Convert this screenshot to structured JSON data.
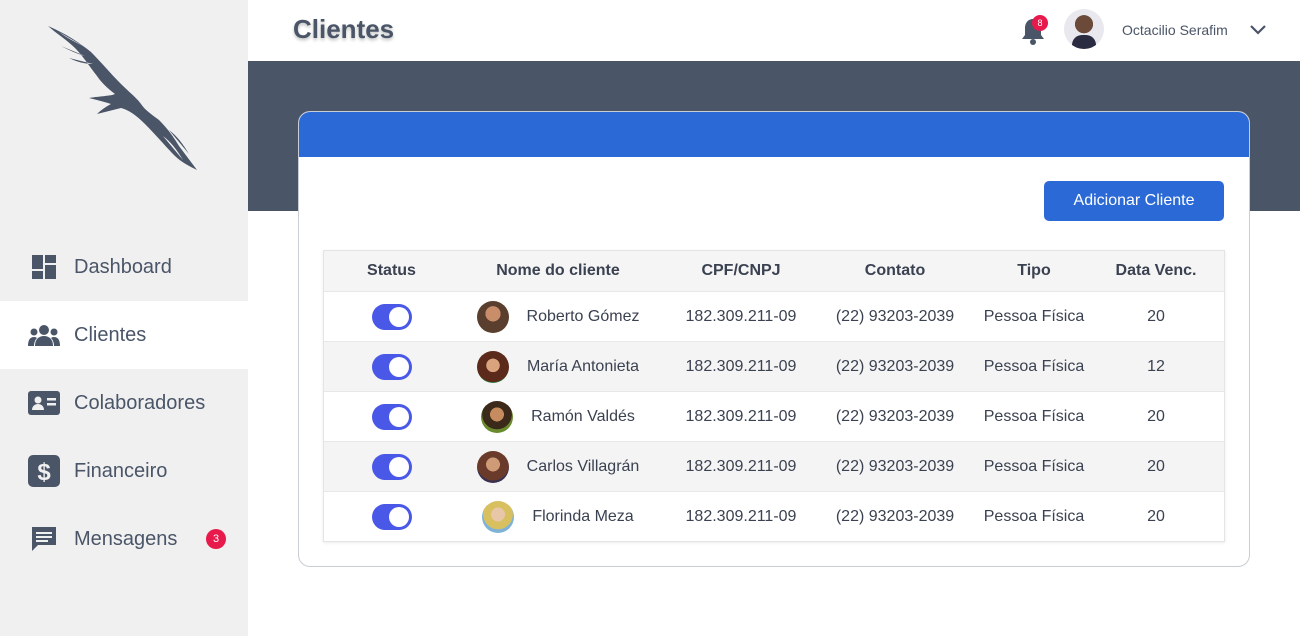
{
  "sidebar": {
    "items": [
      {
        "label": "Dashboard",
        "icon": "dashboard-icon",
        "active": false
      },
      {
        "label": "Clientes",
        "icon": "users-icon",
        "active": true
      },
      {
        "label": "Colaboradores",
        "icon": "id-card-icon",
        "active": false
      },
      {
        "label": "Financeiro",
        "icon": "dollar-icon",
        "active": false
      },
      {
        "label": "Mensagens",
        "icon": "message-icon",
        "active": false,
        "badge": "3"
      }
    ]
  },
  "header": {
    "title": "Clientes",
    "notifications_count": "8",
    "user_name": "Octacilio Serafim"
  },
  "main": {
    "add_button_label": "Adicionar Cliente",
    "columns": [
      "Status",
      "Nome do cliente",
      "CPF/CNPJ",
      "Contato",
      "Tipo",
      "Data Venc."
    ],
    "rows": [
      {
        "status": true,
        "name": "Roberto Gómez",
        "cpf": "182.309.211-09",
        "contato": "(22) 93203-2039",
        "tipo": "Pessoa Física",
        "data": "20"
      },
      {
        "status": true,
        "name": "María Antonieta",
        "cpf": "182.309.211-09",
        "contato": "(22) 93203-2039",
        "tipo": "Pessoa Física",
        "data": "12"
      },
      {
        "status": true,
        "name": "Ramón Valdés",
        "cpf": "182.309.211-09",
        "contato": "(22) 93203-2039",
        "tipo": "Pessoa Física",
        "data": "20"
      },
      {
        "status": true,
        "name": "Carlos Villagrán",
        "cpf": "182.309.211-09",
        "contato": "(22) 93203-2039",
        "tipo": "Pessoa Física",
        "data": "20"
      },
      {
        "status": true,
        "name": "Florinda Meza",
        "cpf": "182.309.211-09",
        "contato": "(22) 93203-2039",
        "tipo": "Pessoa Física",
        "data": "20"
      }
    ]
  },
  "colors": {
    "accent": "#2b6ad6",
    "toggle": "#4a58e8",
    "sidebar_text": "#4a5568",
    "badge": "#e8194b",
    "banner": "#4a5568"
  }
}
